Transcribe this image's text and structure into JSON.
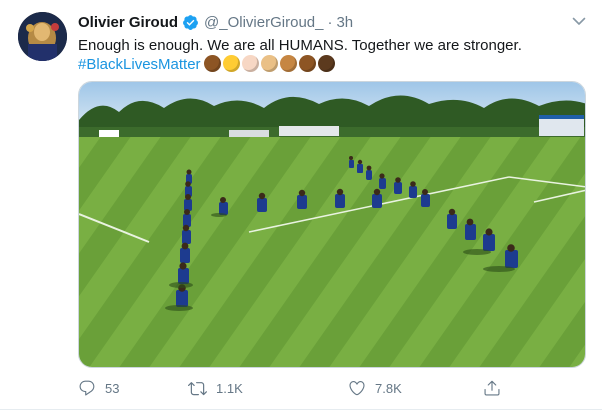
{
  "tweet": {
    "author_name": "Olivier Giroud",
    "handle": "@_OlivierGiroud_",
    "separator": "·",
    "time": "3h",
    "text_line1": "Enough is enough. We are all HUMANS. Together we are stronger.",
    "hashtag": "#BlackLivesMatter",
    "emoji_icons": [
      "clasped-hands-medium-dark",
      "raised-fist-yellow",
      "raised-fist-light",
      "raised-fist-medium-light",
      "raised-fist-medium",
      "raised-fist-medium-dark",
      "raised-fist-dark"
    ],
    "emoji_colors": [
      "#8d5524",
      "#ffcc33",
      "#f7d7c4",
      "#eac086",
      "#c68642",
      "#8d5524",
      "#5c3a1e"
    ]
  },
  "actions": {
    "reply_count": "53",
    "retweet_count": "1.1K",
    "like_count": "7.8K"
  },
  "colors": {
    "accent": "#1b95e0",
    "verified": "#1da1f2",
    "muted": "#657786",
    "text": "#14171a"
  }
}
